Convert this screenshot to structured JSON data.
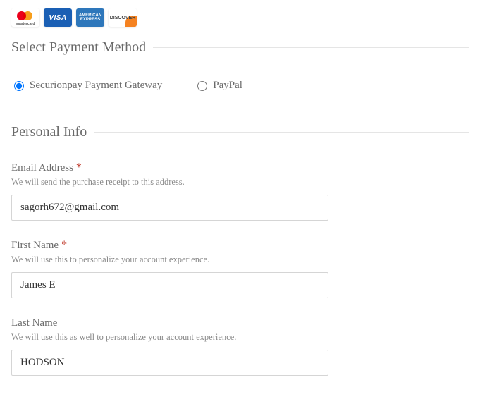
{
  "cards": {
    "mastercard": "mastercard",
    "visa": "VISA",
    "amex": "AMERICAN EXPRESS",
    "discover": "DISCOVER"
  },
  "payment": {
    "legend": "Select Payment Method",
    "options": {
      "securionpay": "Securionpay Payment Gateway",
      "paypal": "PayPal"
    }
  },
  "personal": {
    "legend": "Personal Info",
    "email": {
      "label": "Email Address",
      "required": "*",
      "help": "We will send the purchase receipt to this address.",
      "value": "sagorh672@gmail.com"
    },
    "first_name": {
      "label": "First Name",
      "required": "*",
      "help": "We will use this to personalize your account experience.",
      "value": "James E"
    },
    "last_name": {
      "label": "Last Name",
      "help": "We will use this as well to personalize your account experience.",
      "value": "HODSON"
    }
  }
}
